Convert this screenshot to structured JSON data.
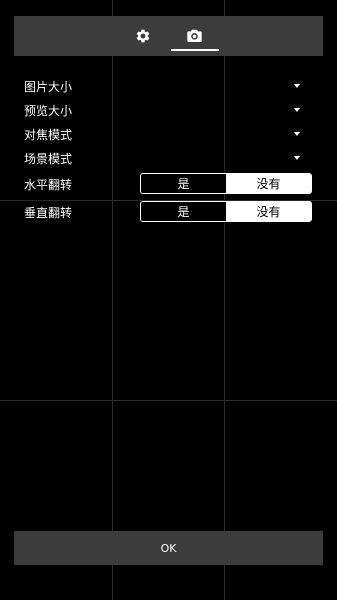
{
  "tabs": [
    {
      "icon": "gear-icon"
    },
    {
      "icon": "camera-icon",
      "selected": true
    }
  ],
  "settings": [
    {
      "label": "图片大小",
      "type": "dropdown"
    },
    {
      "label": "预览大小",
      "type": "dropdown"
    },
    {
      "label": "对焦模式",
      "type": "dropdown"
    },
    {
      "label": "场景模式",
      "type": "dropdown"
    }
  ],
  "toggles": [
    {
      "label": "水平翻转",
      "option_yes": "是",
      "option_no": "没有",
      "selected": "没有"
    },
    {
      "label": "垂直翻转",
      "option_yes": "是",
      "option_no": "没有",
      "selected": "没有"
    }
  ],
  "footer": {
    "ok_label": "OK"
  },
  "colors": {
    "panel": "#3c3c3c",
    "background": "#000000",
    "accent": "#ffffff"
  }
}
